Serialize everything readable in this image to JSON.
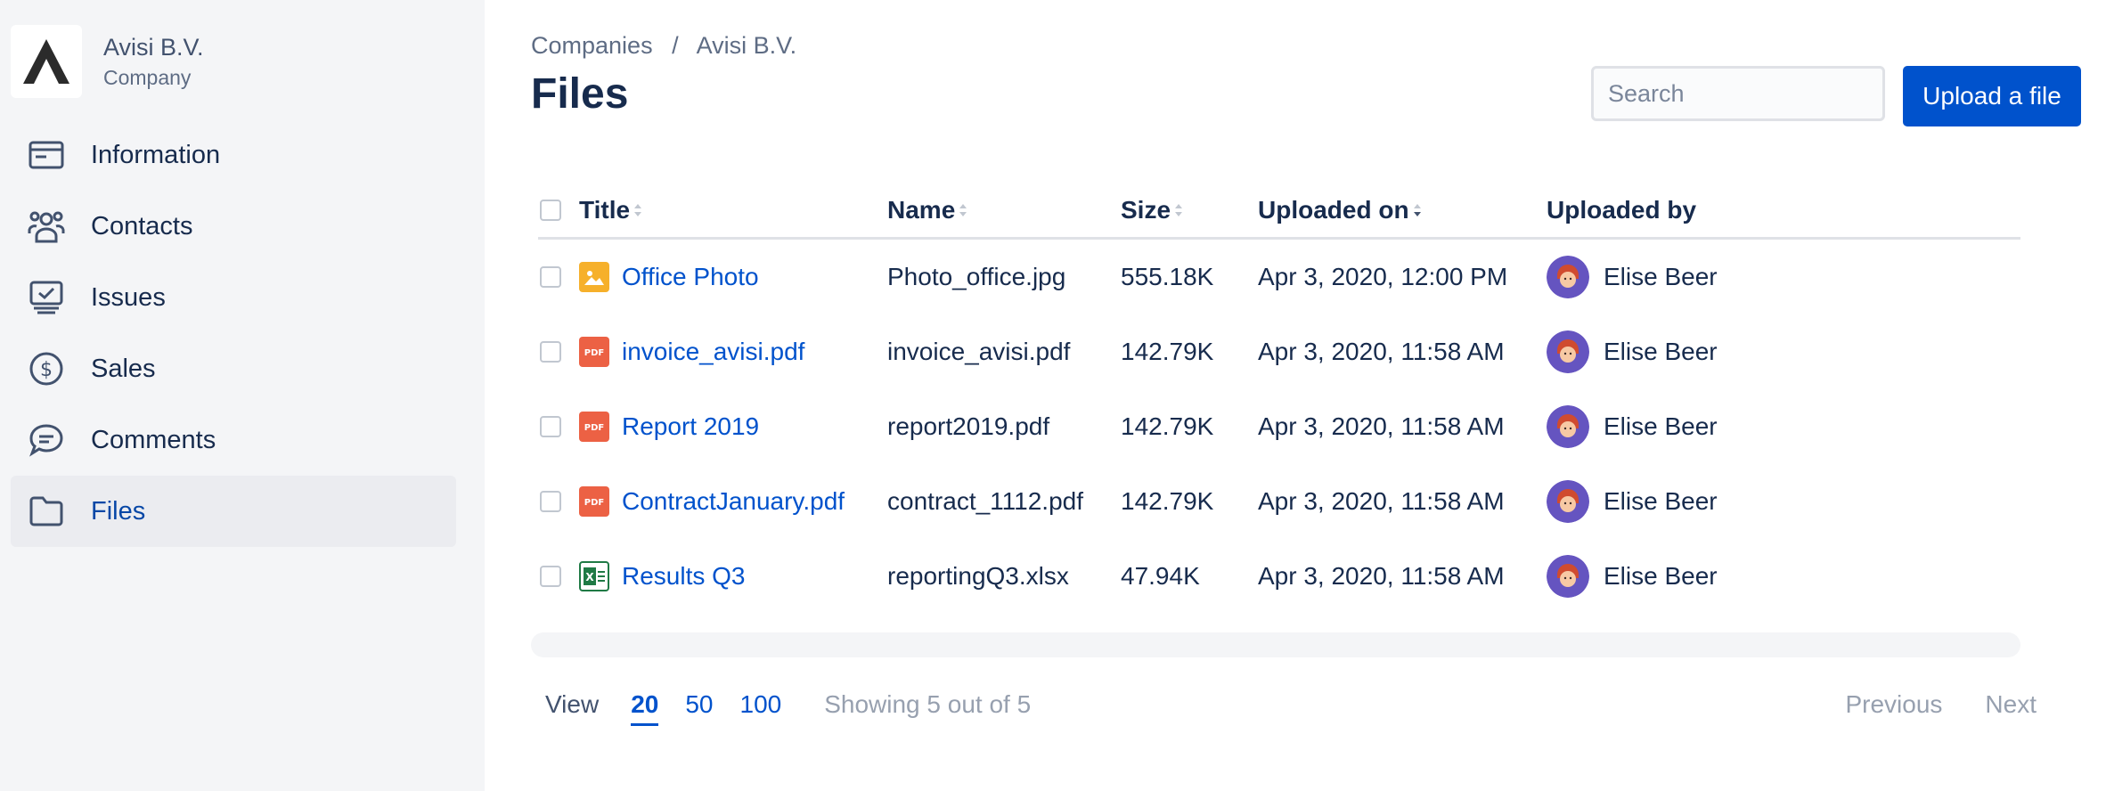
{
  "company": {
    "name": "Avisi B.V.",
    "type": "Company"
  },
  "nav": {
    "items": [
      {
        "label": "Information",
        "icon": "card-icon"
      },
      {
        "label": "Contacts",
        "icon": "people-icon"
      },
      {
        "label": "Issues",
        "icon": "issues-icon"
      },
      {
        "label": "Sales",
        "icon": "dollar-icon"
      },
      {
        "label": "Comments",
        "icon": "comment-icon"
      },
      {
        "label": "Files",
        "icon": "folder-icon",
        "active": true
      }
    ]
  },
  "breadcrumb": {
    "root": "Companies",
    "separator": "/",
    "current": "Avisi B.V."
  },
  "page": {
    "title": "Files"
  },
  "search": {
    "placeholder": "Search"
  },
  "actions": {
    "upload_label": "Upload a file"
  },
  "table": {
    "columns": {
      "title": "Title",
      "name": "Name",
      "size": "Size",
      "uploaded_on": "Uploaded on",
      "uploaded_by": "Uploaded by"
    },
    "rows": [
      {
        "title": "Office Photo",
        "file": "Photo_office.jpg",
        "size": "555.18K",
        "uploaded_on": "Apr 3, 2020, 12:00 PM",
        "uploaded_by": "Elise Beer",
        "type": "image"
      },
      {
        "title": "invoice_avisi.pdf",
        "file": "invoice_avisi.pdf",
        "size": "142.79K",
        "uploaded_on": "Apr 3, 2020, 11:58 AM",
        "uploaded_by": "Elise Beer",
        "type": "pdf"
      },
      {
        "title": "Report 2019",
        "file": "report2019.pdf",
        "size": "142.79K",
        "uploaded_on": "Apr 3, 2020, 11:58 AM",
        "uploaded_by": "Elise Beer",
        "type": "pdf"
      },
      {
        "title": "ContractJanuary.pdf",
        "file": "contract_1112.pdf",
        "size": "142.79K",
        "uploaded_on": "Apr 3, 2020, 11:58 AM",
        "uploaded_by": "Elise Beer",
        "type": "pdf"
      },
      {
        "title": "Results Q3",
        "file": "reportingQ3.xlsx",
        "size": "47.94K",
        "uploaded_on": "Apr 3, 2020, 11:58 AM",
        "uploaded_by": "Elise Beer",
        "type": "excel"
      }
    ]
  },
  "pagination": {
    "view_label": "View",
    "sizes": [
      "20",
      "50",
      "100"
    ],
    "active_size": "20",
    "showing": "Showing 5 out of 5",
    "previous": "Previous",
    "next": "Next"
  },
  "colors": {
    "accent": "#0052cc",
    "pdf": "#ec6144",
    "image": "#f6b02b",
    "excel": "#1f7a45",
    "avatar_bg": "#6554c0"
  }
}
